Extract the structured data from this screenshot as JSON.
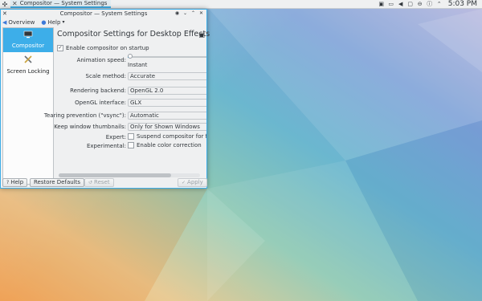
{
  "taskbar": {
    "task_label": "Compositor — System Settings",
    "clock": "5:03 PM"
  },
  "window": {
    "title": "Compositor — System Settings"
  },
  "menubar": {
    "overview": "Overview",
    "help": "Help"
  },
  "sidebar": {
    "items": [
      {
        "label": "Compositor",
        "icon": "display-icon",
        "active": true
      },
      {
        "label": "Screen Locking",
        "icon": "tools-icon",
        "active": false
      }
    ]
  },
  "content": {
    "title": "Compositor Settings for Desktop Effects",
    "enable_on_startup": {
      "label": "Enable compositor on startup",
      "checked": true
    },
    "animation_speed": {
      "label": "Animation speed:",
      "value_text": "Instant",
      "level": 0.02
    },
    "scale_method": {
      "label": "Scale method:",
      "value": "Accurate"
    },
    "rendering_backend": {
      "label": "Rendering backend:",
      "value": "OpenGL 2.0"
    },
    "opengl_interface": {
      "label": "OpenGL interface:",
      "value": "GLX"
    },
    "tearing_prevention": {
      "label": "Tearing prevention (\"vsync\"):",
      "value": "Automatic"
    },
    "keep_thumbnails": {
      "label": "Keep window thumbnails:",
      "value": "Only for Shown Windows"
    },
    "expert": {
      "label": "Expert:",
      "checkbox_label": "Suspend compositor for full sc",
      "checked": false
    },
    "experimental": {
      "label": "Experimental:",
      "checkbox_label": "Enable color correction",
      "checked": false
    }
  },
  "buttons": {
    "help": "Help",
    "restore_defaults": "Restore Defaults",
    "reset": "Reset",
    "apply": "Apply"
  }
}
